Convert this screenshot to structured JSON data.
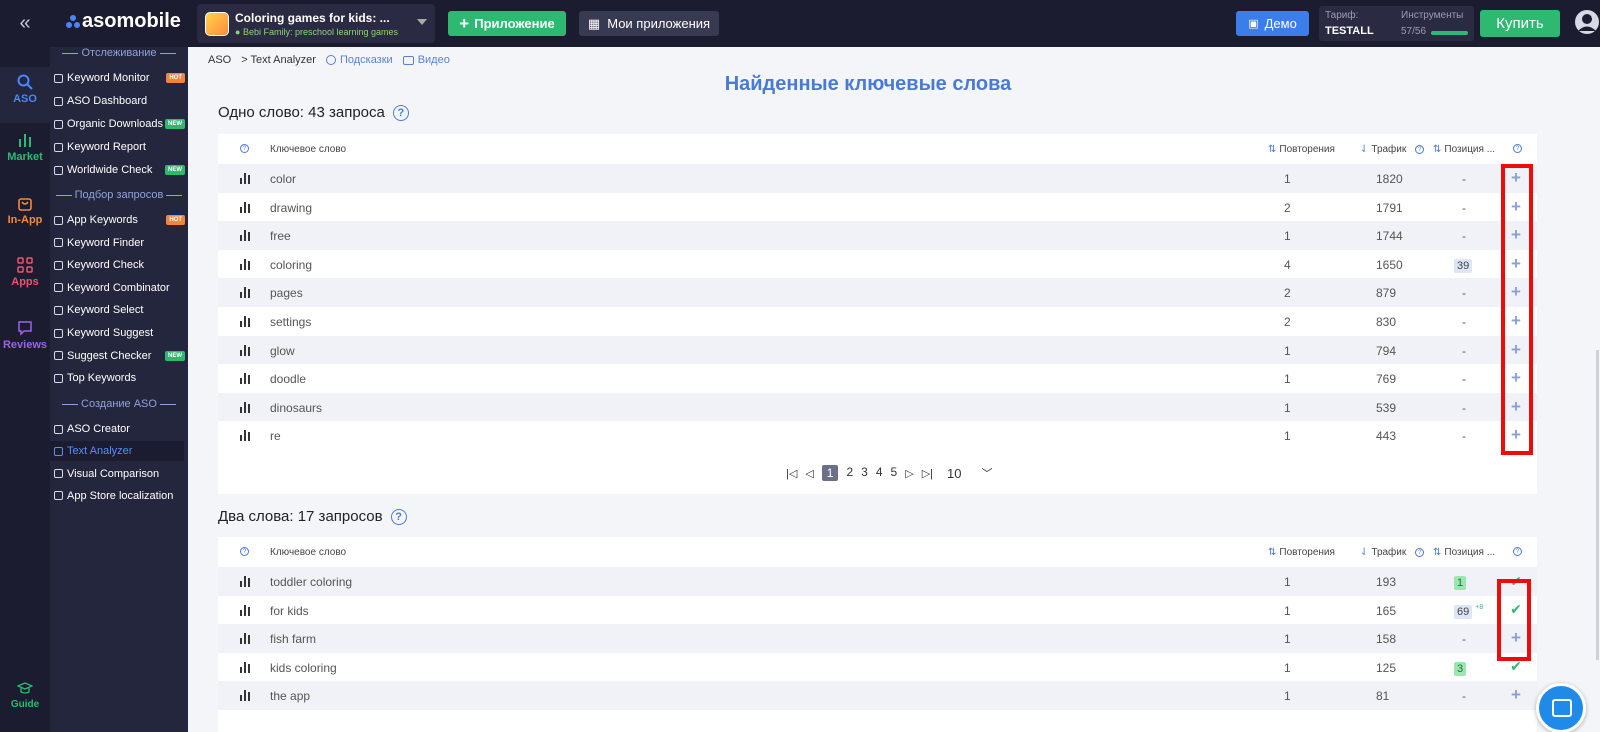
{
  "topbar": {
    "logo_text": "asomobile",
    "app_title": "Coloring games for kids: ...",
    "app_developer": "Bebi Family: preschool learning games",
    "add_app_label": "Приложение",
    "my_apps_label": "Мои приложения",
    "demo_label": "Демо",
    "tariff_label": "Тариф:",
    "tariff_plan": "TESTALL",
    "tools_label": "Инструменты",
    "tools_value": "57/56",
    "tools_fill": 1.0,
    "buy_label": "Купить"
  },
  "rail": {
    "aso": "ASO",
    "market": "Market",
    "inapp": "In-App",
    "apps": "Apps",
    "reviews": "Reviews",
    "guide": "Guide"
  },
  "sidebar": {
    "section_tracking": "Отслеживание",
    "section_selection": "Подбор запросов",
    "section_create": "Создание ASO",
    "tracking": [
      {
        "label": "Keyword Monitor",
        "badge": "HOT"
      },
      {
        "label": "ASO Dashboard",
        "badge": ""
      },
      {
        "label": "Organic Downloads",
        "badge": "NEW"
      },
      {
        "label": "Keyword Report",
        "badge": ""
      },
      {
        "label": "Worldwide Check",
        "badge": "NEW"
      }
    ],
    "selection": [
      {
        "label": "App Keywords",
        "badge": "HOT"
      },
      {
        "label": "Keyword Finder",
        "badge": ""
      },
      {
        "label": "Keyword Check",
        "badge": ""
      },
      {
        "label": "Keyword Combinator",
        "badge": ""
      },
      {
        "label": "Keyword Select",
        "badge": ""
      },
      {
        "label": "Keyword Suggest",
        "badge": ""
      },
      {
        "label": "Suggest Checker",
        "badge": "NEW"
      },
      {
        "label": "Top Keywords",
        "badge": ""
      }
    ],
    "create": [
      {
        "label": "ASO Creator"
      },
      {
        "label": "Text Analyzer"
      },
      {
        "label": "Visual Comparison"
      },
      {
        "label": "App Store localization"
      }
    ]
  },
  "breadcrumb": {
    "root": "ASO",
    "current": "> Text Analyzer",
    "hints": "Подсказки",
    "video": "Видео"
  },
  "page_title": "Найденные ключевые слова",
  "table_headers": {
    "keyword": "Ключевое слово",
    "repeats": "Повторения",
    "traffic": "Трафик",
    "position": "Позиция ..."
  },
  "one_word": {
    "title": "Одно слово: 43 запроса",
    "rows": [
      {
        "keyword": "color",
        "repeats": "1",
        "traffic": "1820",
        "position": "-",
        "pos_style": "",
        "delta": "",
        "action": "plus"
      },
      {
        "keyword": "drawing",
        "repeats": "2",
        "traffic": "1791",
        "position": "-",
        "pos_style": "",
        "delta": "",
        "action": "plus"
      },
      {
        "keyword": "free",
        "repeats": "1",
        "traffic": "1744",
        "position": "-",
        "pos_style": "",
        "delta": "",
        "action": "plus"
      },
      {
        "keyword": "coloring",
        "repeats": "4",
        "traffic": "1650",
        "position": "39",
        "pos_style": "blue",
        "delta": "",
        "action": "plus"
      },
      {
        "keyword": "pages",
        "repeats": "2",
        "traffic": "879",
        "position": "-",
        "pos_style": "",
        "delta": "",
        "action": "plus"
      },
      {
        "keyword": "settings",
        "repeats": "2",
        "traffic": "830",
        "position": "-",
        "pos_style": "",
        "delta": "",
        "action": "plus"
      },
      {
        "keyword": "glow",
        "repeats": "1",
        "traffic": "794",
        "position": "-",
        "pos_style": "",
        "delta": "",
        "action": "plus"
      },
      {
        "keyword": "doodle",
        "repeats": "1",
        "traffic": "769",
        "position": "-",
        "pos_style": "",
        "delta": "",
        "action": "plus"
      },
      {
        "keyword": "dinosaurs",
        "repeats": "1",
        "traffic": "539",
        "position": "-",
        "pos_style": "",
        "delta": "",
        "action": "plus"
      },
      {
        "keyword": "re",
        "repeats": "1",
        "traffic": "443",
        "position": "-",
        "pos_style": "",
        "delta": "",
        "action": "plus"
      }
    ],
    "pager": {
      "pages": [
        "1",
        "2",
        "3",
        "4",
        "5"
      ],
      "per_page": "10"
    }
  },
  "two_words": {
    "title": "Два слова: 17 запросов",
    "rows": [
      {
        "keyword": "toddler coloring",
        "repeats": "1",
        "traffic": "193",
        "position": "1",
        "pos_style": "green",
        "delta": "",
        "action": "check"
      },
      {
        "keyword": "for kids",
        "repeats": "1",
        "traffic": "165",
        "position": "69",
        "pos_style": "blue",
        "delta": "+8",
        "action": "check"
      },
      {
        "keyword": "fish farm",
        "repeats": "1",
        "traffic": "158",
        "position": "-",
        "pos_style": "",
        "delta": "",
        "action": "plus"
      },
      {
        "keyword": "kids coloring",
        "repeats": "1",
        "traffic": "125",
        "position": "3",
        "pos_style": "green",
        "delta": "",
        "action": "check"
      },
      {
        "keyword": "the app",
        "repeats": "1",
        "traffic": "81",
        "position": "-",
        "pos_style": "",
        "delta": "",
        "action": "plus"
      }
    ]
  },
  "colors": {
    "accent": "#4a7ad8",
    "green": "#2fb872",
    "highlight": "#f00b0b",
    "dark": "#1b1c30"
  }
}
